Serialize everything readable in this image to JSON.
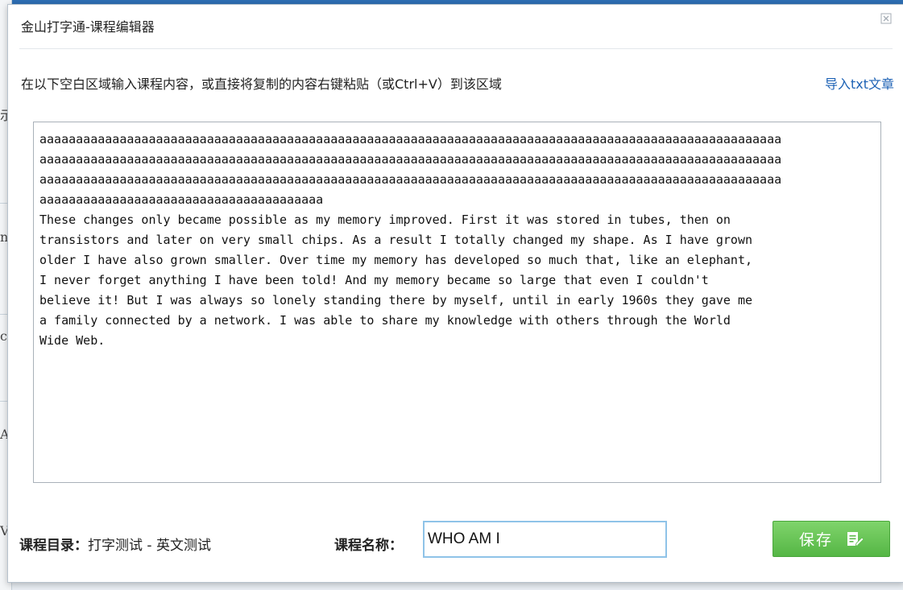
{
  "window": {
    "title": "金山打字通-课程编辑器",
    "close_icon": "close-icon"
  },
  "instruction": "在以下空白区域输入课程内容，或直接将复制的内容右键粘贴（或Ctrl+V）到该区域",
  "import_link": "导入txt文章",
  "editor": {
    "content": "aaaaaaaaaaaaaaaaaaaaaaaaaaaaaaaaaaaaaaaaaaaaaaaaaaaaaaaaaaaaaaaaaaaaaaaaaaaaaaaaaaaaaaaaaaaaaaaaaaaaaa\naaaaaaaaaaaaaaaaaaaaaaaaaaaaaaaaaaaaaaaaaaaaaaaaaaaaaaaaaaaaaaaaaaaaaaaaaaaaaaaaaaaaaaaaaaaaaaaaaaaaaa\naaaaaaaaaaaaaaaaaaaaaaaaaaaaaaaaaaaaaaaaaaaaaaaaaaaaaaaaaaaaaaaaaaaaaaaaaaaaaaaaaaaaaaaaaaaaaaaaaaaaaa\naaaaaaaaaaaaaaaaaaaaaaaaaaaaaaaaaaaaaaa\nThese changes only became possible as my memory improved. First it was stored in tubes, then on\ntransistors and later on very small chips. As a result I totally changed my shape. As I have grown\nolder I have also grown smaller. Over time my memory has developed so much that, like an elephant,\nI never forget anything I have been told! And my memory became so large that even I couldn't\nbelieve it! But I was always so lonely standing there by myself, until in early 1960s they gave me\na family connected by a network. I was able to share my knowledge with others through the World\nWide Web."
  },
  "footer": {
    "catalog_label": "课程目录：",
    "catalog_value": "打字测试 - 英文测试",
    "name_label": "课程名称：",
    "name_value": "WHO AM I",
    "save_label": "保存",
    "save_icon": "edit-save-icon"
  },
  "colors": {
    "link": "#1d62b5",
    "save_green": "#5dbb4c",
    "input_border": "#8fc3e8"
  }
}
